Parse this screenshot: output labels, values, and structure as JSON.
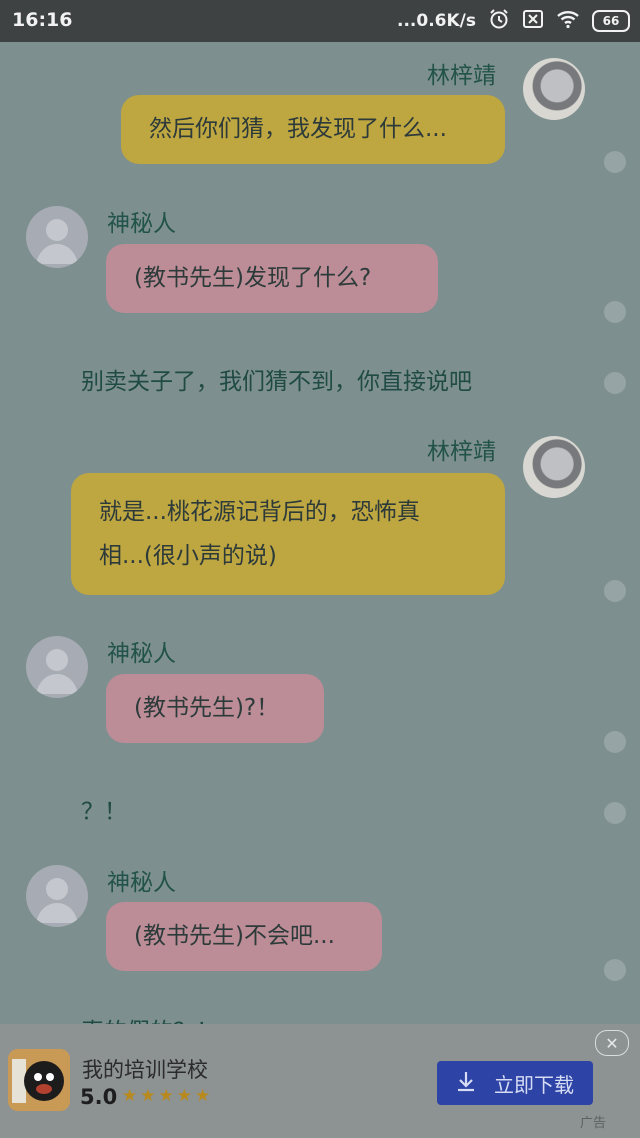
{
  "status_bar": {
    "time": "16:16",
    "network_speed": "...0.6K/s",
    "battery": "66"
  },
  "messages": [
    {
      "sender": "林梓靖",
      "text": "然后你们猜，我发现了什么..."
    },
    {
      "sender": "神秘人",
      "text": "(教书先生)发现了什么?"
    },
    {
      "text": "别卖关子了，我们猜不到，你直接说吧"
    },
    {
      "sender": "林梓靖",
      "text_line1": "就是...桃花源记背后的，恐怖真",
      "text_line2": "相...(很小声的说)"
    },
    {
      "sender": "神秘人",
      "text": "(教书先生)?！"
    },
    {
      "text": "？！"
    },
    {
      "sender": "神秘人",
      "text": "(教书先生)不会吧..."
    },
    {
      "text": "真的假的？！"
    }
  ],
  "ad": {
    "app_name": "我的培训学校",
    "rating": "5.0",
    "stars": "★★★★★",
    "download_label": "立即下载",
    "ad_label": "广告",
    "close_symbol": "✕"
  },
  "colors": {
    "yellow_bubble": "#bea640",
    "pink_bubble": "#bc8d97",
    "download_button": "#2d43a5"
  }
}
